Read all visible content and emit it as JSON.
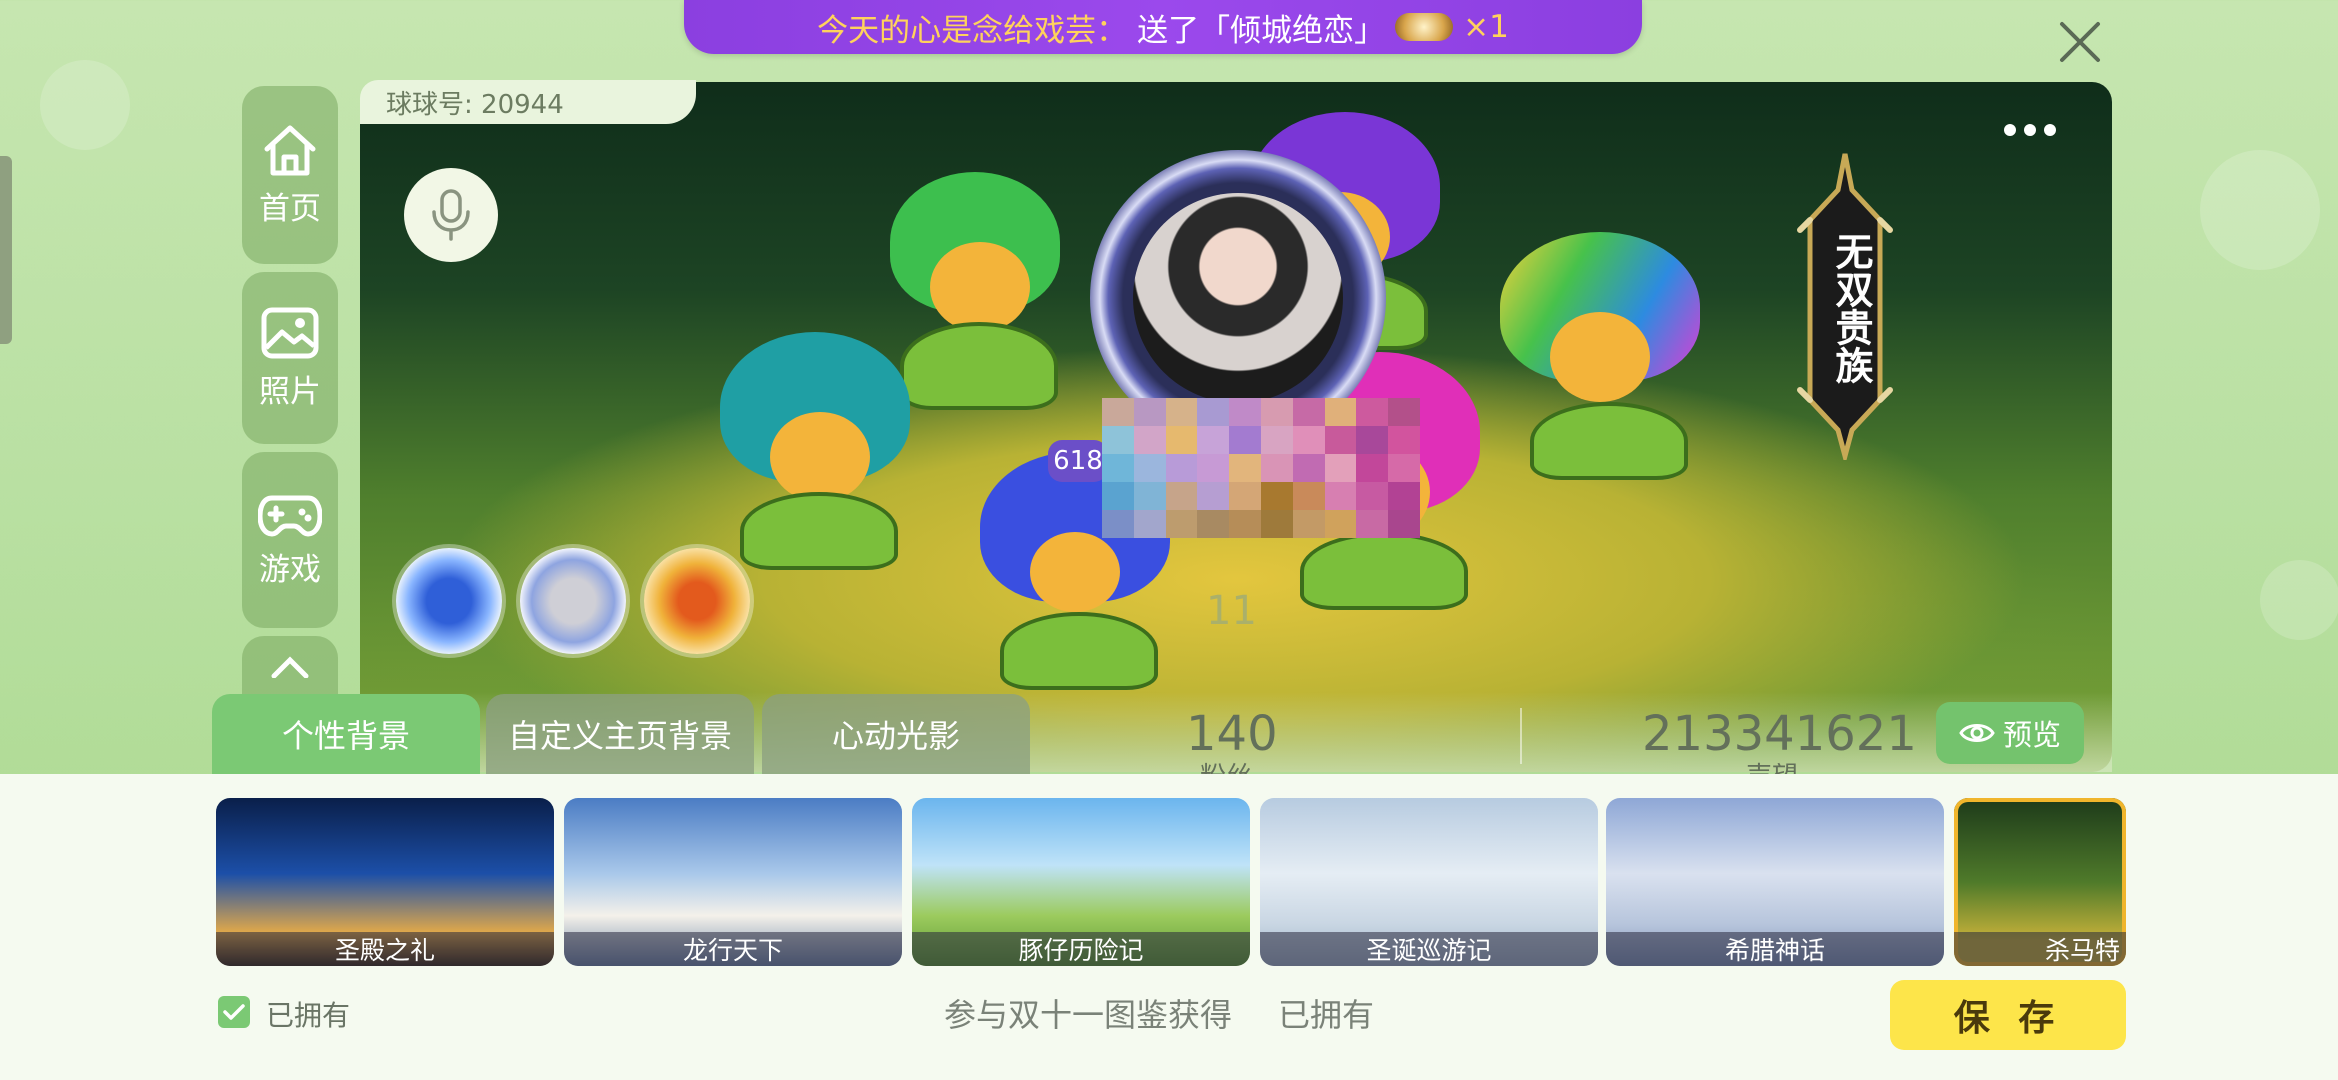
{
  "banner": {
    "prefix": "今天的心是念给戏芸：",
    "gift_text": "送了「倾城绝恋」",
    "multiplier": "×1"
  },
  "header": {
    "user_id": "球球号: 20944"
  },
  "nav": {
    "home": "首页",
    "photos": "照片",
    "games": "游戏"
  },
  "scene": {
    "level": "618",
    "count": "11",
    "nobility": "无双贵族"
  },
  "tabs": [
    "个性背景",
    "自定义主页背景",
    "心动光影"
  ],
  "stats": {
    "fans_value": "140",
    "fans_label": "粉丝",
    "popularity_value": "213341621",
    "popularity_label": "声望"
  },
  "preview_label": "预览",
  "backgrounds": [
    {
      "name": "圣殿之礼"
    },
    {
      "name": "龙行天下"
    },
    {
      "name": "豚仔历险记"
    },
    {
      "name": "圣诞巡游记"
    },
    {
      "name": "希腊神话"
    },
    {
      "name": "杀马特"
    }
  ],
  "footer": {
    "owned_filter": "已拥有",
    "source": "参与双十一图鉴获得",
    "status": "已拥有",
    "save": "保 存"
  },
  "colors": {
    "accent_green": "#7bc974",
    "banner_purple": "#8b3fe0",
    "save_yellow": "#fde54a",
    "selected_border": "#f0b52c"
  }
}
